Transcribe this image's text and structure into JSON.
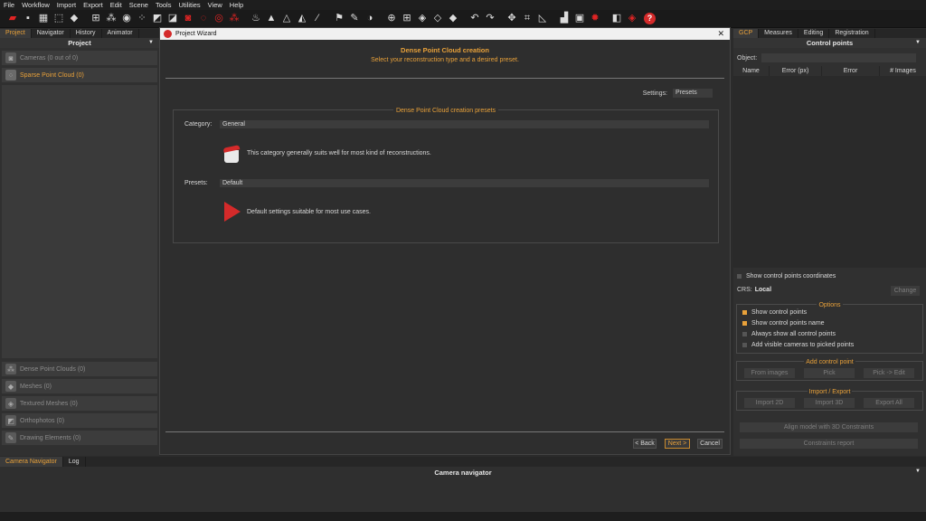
{
  "menu": [
    "File",
    "Workflow",
    "Import",
    "Export",
    "Edit",
    "Scene",
    "Tools",
    "Utilities",
    "View",
    "Help"
  ],
  "toolbar_icons": [
    {
      "name": "open-project-icon",
      "glyph": "▰",
      "color": "red"
    },
    {
      "name": "save-icon",
      "glyph": "▪"
    },
    {
      "name": "cameras-icon",
      "glyph": "▦"
    },
    {
      "name": "add-cameras-icon",
      "glyph": "⬚"
    },
    {
      "name": "cube-icon",
      "glyph": "◆"
    },
    {
      "name": "sep"
    },
    {
      "name": "mesh-select-icon",
      "glyph": "⊞"
    },
    {
      "name": "filter-icon",
      "glyph": "⁂"
    },
    {
      "name": "sphere-icon",
      "glyph": "◉"
    },
    {
      "name": "points-icon",
      "glyph": "⁘"
    },
    {
      "name": "ortho-icon",
      "glyph": "◩"
    },
    {
      "name": "crop-icon",
      "glyph": "◪"
    },
    {
      "name": "camera-icon",
      "glyph": "◙",
      "color": "red"
    },
    {
      "name": "rotate-icon",
      "glyph": "◌",
      "color": "red"
    },
    {
      "name": "record-icon",
      "glyph": "◎",
      "color": "red"
    },
    {
      "name": "cluster-icon",
      "glyph": "⁂",
      "color": "red"
    },
    {
      "name": "sep"
    },
    {
      "name": "light-icon",
      "glyph": "♨"
    },
    {
      "name": "triangles-icon",
      "glyph": "▲"
    },
    {
      "name": "wire-triangle-icon",
      "glyph": "△"
    },
    {
      "name": "textured-triangle-icon",
      "glyph": "◭"
    },
    {
      "name": "brush-icon",
      "glyph": "⁄"
    },
    {
      "name": "sep"
    },
    {
      "name": "gcp-icon",
      "glyph": "⚑"
    },
    {
      "name": "measure-icon",
      "glyph": "✎"
    },
    {
      "name": "shapes-icon",
      "glyph": "◑"
    },
    {
      "name": "sep"
    },
    {
      "name": "grid-sphere-icon",
      "glyph": "⊕"
    },
    {
      "name": "grid-icon",
      "glyph": "⊞"
    },
    {
      "name": "shaded-cube-icon",
      "glyph": "◈"
    },
    {
      "name": "wire-cube-icon",
      "glyph": "◇"
    },
    {
      "name": "solid-cube-icon",
      "glyph": "◆"
    },
    {
      "name": "sep"
    },
    {
      "name": "undo-icon",
      "glyph": "↶"
    },
    {
      "name": "redo-icon",
      "glyph": "↷"
    },
    {
      "name": "sep"
    },
    {
      "name": "transform-icon",
      "glyph": "✥"
    },
    {
      "name": "crop-tool-icon",
      "glyph": "⌗"
    },
    {
      "name": "ruler-icon",
      "glyph": "◺"
    },
    {
      "name": "sep"
    },
    {
      "name": "histogram-icon",
      "glyph": "▟"
    },
    {
      "name": "calendar-icon",
      "glyph": "▣"
    },
    {
      "name": "settings-gear-icon",
      "glyph": "✹",
      "color": "red"
    },
    {
      "name": "sep"
    },
    {
      "name": "view-cube-icon",
      "glyph": "◧"
    },
    {
      "name": "red-cube-icon",
      "glyph": "◈",
      "color": "red"
    }
  ],
  "left_panel": {
    "tabs": [
      "Project",
      "Navigator",
      "History",
      "Animator"
    ],
    "title": "Project",
    "items_top": [
      "Cameras (0 out of 0)",
      "Sparse Point Cloud (0)"
    ],
    "items_bottom": [
      "Dense Point Clouds (0)",
      "Meshes (0)",
      "Textured Meshes (0)",
      "Orthophotos (0)",
      "Drawing Elements (0)"
    ]
  },
  "dialog": {
    "title": "Project Wizard",
    "heading": "Dense Point Cloud creation",
    "subheading": "Select your reconstruction type and a desired preset.",
    "settings_label": "Settings:",
    "settings_value": "Presets",
    "group_title": "Dense Point Cloud creation presets",
    "category_label": "Category:",
    "category_value": "General",
    "category_desc": "This category generally suits well for most kind of reconstructions.",
    "presets_label": "Presets:",
    "presets_value": "Default",
    "presets_desc": "Default settings suitable for most use cases.",
    "back": "< Back",
    "next": "Next >",
    "cancel": "Cancel"
  },
  "right_panel": {
    "tabs": [
      "GCP",
      "Measures",
      "Editing",
      "Registration"
    ],
    "title": "Control points",
    "object_label": "Object:",
    "columns": [
      "Name",
      "Error (px)",
      "Error",
      "# Images"
    ],
    "show_coords": "Show control points coordinates",
    "crs_label": "CRS:",
    "crs_value": "Local",
    "change": "Change",
    "options_title": "Options",
    "options": [
      {
        "label": "Show control points",
        "checked": true
      },
      {
        "label": "Show control points name",
        "checked": true
      },
      {
        "label": "Always show all control points",
        "checked": false
      },
      {
        "label": "Add visible cameras to picked points",
        "checked": false
      }
    ],
    "add_title": "Add control point",
    "add_buttons": [
      "From images",
      "Pick",
      "Pick -> Edit"
    ],
    "io_title": "Import / Export",
    "io_buttons": [
      "Import 2D",
      "Import 3D",
      "Export All"
    ],
    "align": "Align model with 3D Constraints",
    "report": "Constraints report"
  },
  "bottom": {
    "tabs": [
      "Camera Navigator",
      "Log"
    ],
    "title": "Camera navigator"
  }
}
